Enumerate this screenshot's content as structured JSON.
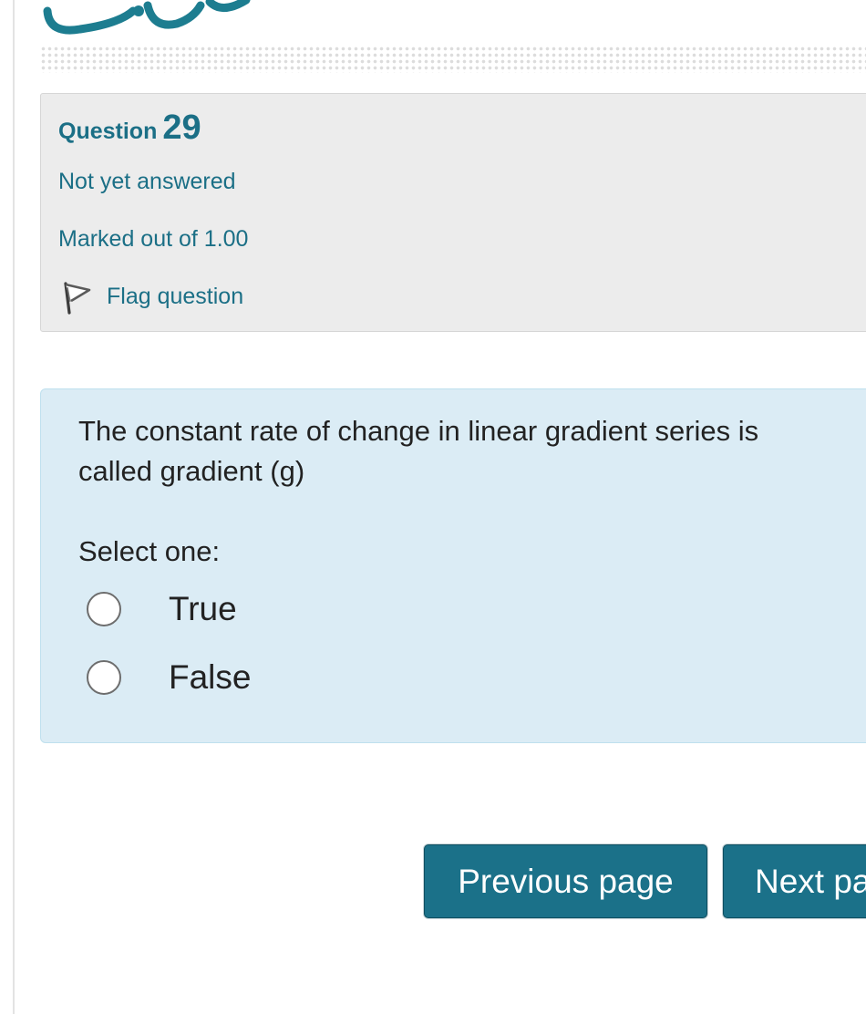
{
  "question": {
    "label": "Question",
    "number": "29",
    "state": "Not yet answered",
    "grade": "Marked out of 1.00",
    "flag_label": "Flag question",
    "flag_icon": "flag-icon",
    "text": "The constant rate of change in linear gradient series is called gradient (g)",
    "prompt": "Select one:",
    "options": [
      {
        "label": "True",
        "selected": false
      },
      {
        "label": "False",
        "selected": false
      }
    ]
  },
  "navigation": {
    "previous_label": "Previous page",
    "next_label": "Next page"
  },
  "colors": {
    "accent": "#1b6f86",
    "button": "#1b7189",
    "info_box": "#ececec",
    "content_box": "#dbecf5"
  }
}
